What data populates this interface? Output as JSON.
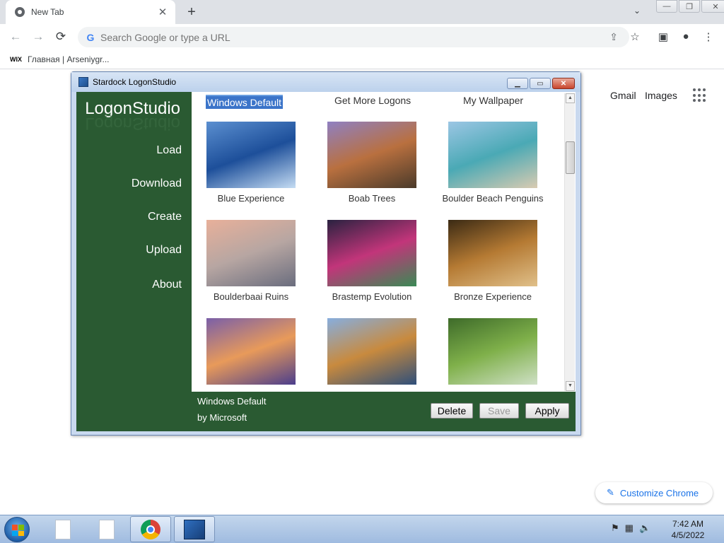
{
  "browser": {
    "tab_title": "New Tab",
    "tab_close": "✕",
    "new_tab": "+",
    "tab_search": "⌄",
    "min": "—",
    "restore": "❐",
    "close": "✕",
    "back": "←",
    "forward": "→",
    "reload": "⟳",
    "omnibox_placeholder": "Search Google or type a URL",
    "bookmark_favicon": "WIX",
    "bookmark_label": "Главная | Arseniygr...",
    "ntp_links": [
      "Gmail",
      "Images"
    ],
    "customize_label": "Customize Chrome"
  },
  "logonstudio": {
    "window_title": "Stardock LogonStudio",
    "logo": "LogonStudio",
    "nav": [
      "Load",
      "Download",
      "Create",
      "Upload",
      "About"
    ],
    "tabs": [
      "Windows Default",
      "Get More Logons",
      "My Wallpaper"
    ],
    "active_tab": "Windows Default",
    "thumbnails": [
      {
        "label": "Blue Experience",
        "colors": [
          "#5b8fd0",
          "#1d4f9a",
          "#c5dcf3"
        ]
      },
      {
        "label": "Boab Trees",
        "colors": [
          "#8f80c2",
          "#b9703f",
          "#4a3a2a"
        ]
      },
      {
        "label": "Boulder Beach Penguins",
        "colors": [
          "#9cc6e4",
          "#4aa9b5",
          "#d9cbb1"
        ]
      },
      {
        "label": "Boulderbaai Ruins",
        "colors": [
          "#e8b09a",
          "#b7a6a2",
          "#6a6d7e"
        ]
      },
      {
        "label": "Brastemp Evolution",
        "colors": [
          "#2a2240",
          "#c2357a",
          "#3a8a55"
        ]
      },
      {
        "label": "Bronze Experience",
        "colors": [
          "#3b2a14",
          "#b57a33",
          "#e0c08a"
        ]
      },
      {
        "label": "",
        "colors": [
          "#7a5fa8",
          "#e89a5a",
          "#4b3e8c"
        ]
      },
      {
        "label": "",
        "colors": [
          "#87aede",
          "#c88a3e",
          "#2f4f7a"
        ]
      },
      {
        "label": "",
        "colors": [
          "#3e6b2a",
          "#7fb04a",
          "#cfe0c6"
        ]
      }
    ],
    "selected_name": "Windows Default",
    "selected_author": "by Microsoft",
    "buttons": {
      "delete": "Delete",
      "save": "Save",
      "apply": "Apply"
    },
    "sidebar_color": "#2a5a32"
  },
  "taskbar": {
    "time": "7:42 AM",
    "date": "4/5/2022"
  }
}
